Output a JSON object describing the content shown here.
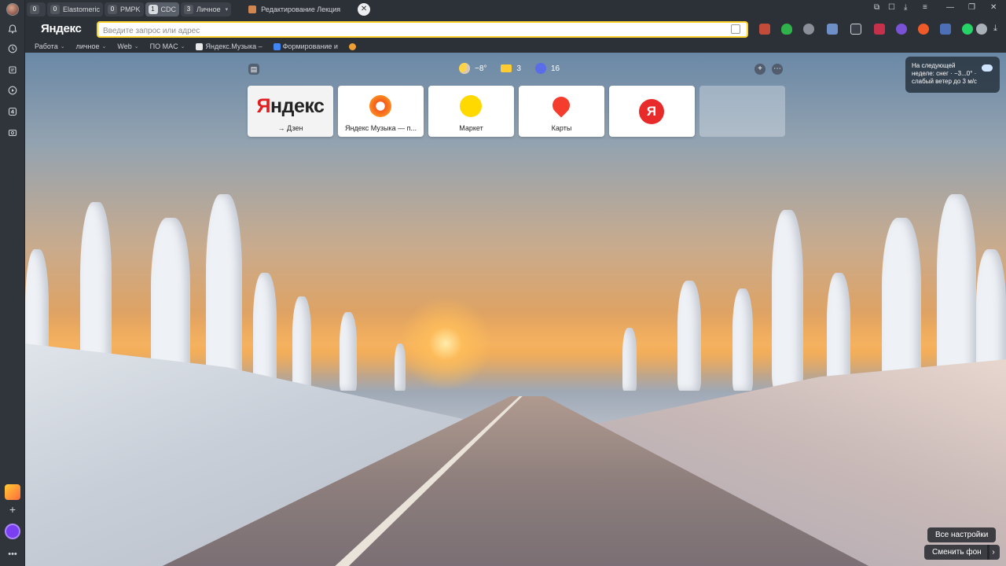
{
  "tabs": {
    "groups": [
      {
        "count": "0",
        "label": ""
      },
      {
        "count": "0",
        "label": "Elastomeric"
      },
      {
        "count": "0",
        "label": "PMPK"
      },
      {
        "count": "1",
        "label": "CDC"
      },
      {
        "count": "3",
        "label": "Личное"
      }
    ],
    "active_tab_title": "Редактирование Лекция",
    "close_label": "✕"
  },
  "address_bar": {
    "logo": "Яндекс",
    "placeholder": "Введите запрос или адрес"
  },
  "bookmarks": [
    {
      "label": "Работа",
      "has_menu": true
    },
    {
      "label": "личное",
      "has_menu": true
    },
    {
      "label": "Web",
      "has_menu": true
    },
    {
      "label": "ПО MAC",
      "has_menu": true
    },
    {
      "label": "Яндекс.Музыка –",
      "has_menu": false
    },
    {
      "label": "Формирование и",
      "has_menu": false
    }
  ],
  "widgets": {
    "weather": "−8°",
    "mail_count": "3",
    "messenger_count": "16"
  },
  "tiles": [
    {
      "logo_part1": "Я",
      "logo_part2": "ндекс",
      "label": "→ Дзен"
    },
    {
      "label": "Яндекс Музыка — п..."
    },
    {
      "label": "Маркет"
    },
    {
      "label": "Карты"
    },
    {
      "label": ""
    },
    {
      "label": ""
    }
  ],
  "weather_hint": {
    "line1": "На следующей",
    "line2": "неделе: снег · −3...0° ·",
    "line3": "слабый ветер до 3 м/с"
  },
  "bottom": {
    "settings": "Все настройки",
    "change_bg": "Сменить фон",
    "arrow": "›"
  },
  "colors": {
    "accent_yellow": "#ffd22e",
    "yandex_red": "#e21d1d",
    "chrome_bg": "#2c3037"
  }
}
